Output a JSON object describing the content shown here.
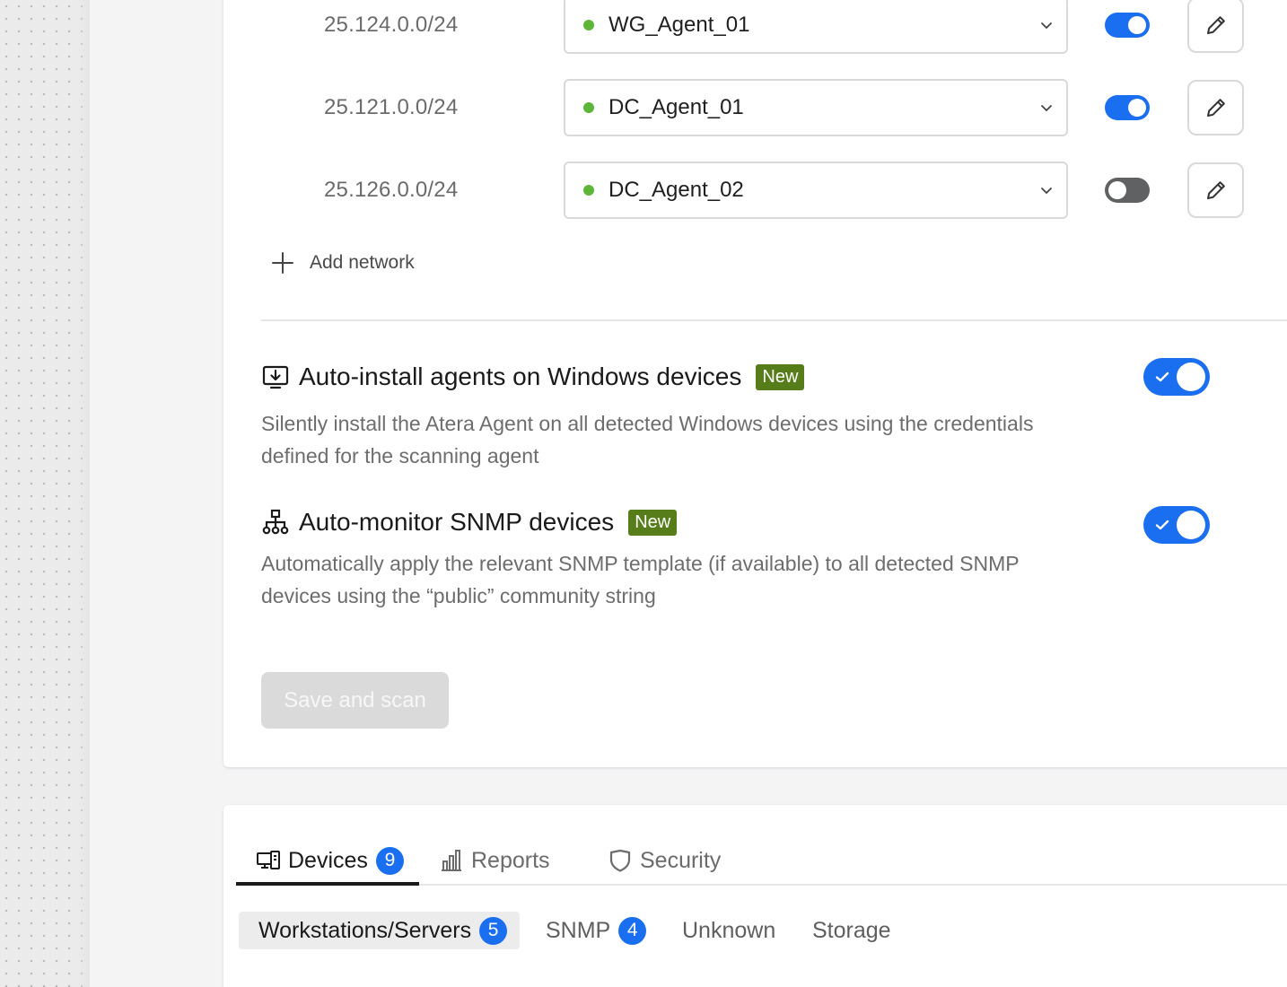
{
  "networks": [
    {
      "cidr": "25.124.0.0/24",
      "agent": "WG_Agent_01",
      "agent_status_color": "#5db53a",
      "enabled": true
    },
    {
      "cidr": "25.121.0.0/24",
      "agent": "DC_Agent_01",
      "agent_status_color": "#5db53a",
      "enabled": true
    },
    {
      "cidr": "25.126.0.0/24",
      "agent": "DC_Agent_02",
      "agent_status_color": "#5db53a",
      "enabled": false
    }
  ],
  "add_network_label": "Add network",
  "features": {
    "auto_install": {
      "title": "Auto-install agents on Windows devices",
      "badge": "New",
      "description": "Silently install the Atera Agent on all detected Windows devices using the credentials defined for the scanning agent",
      "enabled": true,
      "icon": "monitor-download-icon"
    },
    "auto_monitor": {
      "title": "Auto-monitor SNMP devices",
      "badge": "New",
      "description": "Automatically apply the relevant SNMP template (if available) to all detected SNMP devices using the “public” community string",
      "enabled": true,
      "icon": "network-topology-icon"
    }
  },
  "save_button_label": "Save and scan",
  "tabs": [
    {
      "label": "Devices",
      "count": "9",
      "icon": "devices-icon",
      "active": true
    },
    {
      "label": "Reports",
      "icon": "bar-chart-icon",
      "active": false
    },
    {
      "label": "Security",
      "icon": "shield-icon",
      "active": false
    }
  ],
  "subtabs": [
    {
      "label": "Workstations/Servers",
      "count": "5",
      "active": true
    },
    {
      "label": "SNMP",
      "count": "4",
      "active": false
    },
    {
      "label": "Unknown",
      "active": false
    },
    {
      "label": "Storage",
      "active": false
    }
  ],
  "colors": {
    "accent": "#1a6ef0",
    "badge_new": "#567d1a",
    "toggle_off": "#5f6163",
    "agent_online": "#5db53a"
  }
}
